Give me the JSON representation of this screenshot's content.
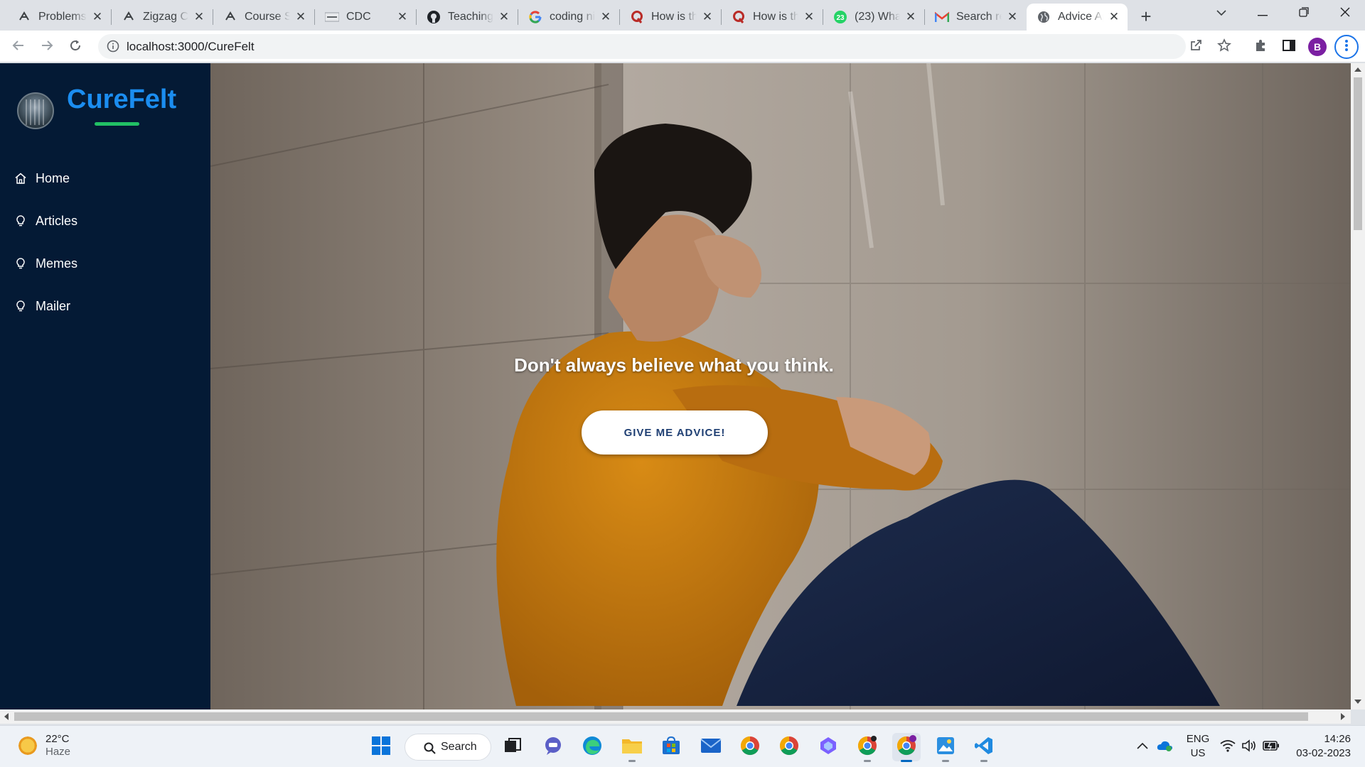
{
  "browser": {
    "tabs": [
      {
        "title": "Problems",
        "favicon": "gfg-icon"
      },
      {
        "title": "Zigzag Co",
        "favicon": "gfg-icon"
      },
      {
        "title": "Course Sc",
        "favicon": "gfg-icon"
      },
      {
        "title": "CDC",
        "favicon": "cdc-icon"
      },
      {
        "title": "Teaching",
        "favicon": "github-icon"
      },
      {
        "title": "coding ni",
        "favicon": "google-icon"
      },
      {
        "title": "How is th",
        "favicon": "quora-icon"
      },
      {
        "title": "How is th",
        "favicon": "quora-icon"
      },
      {
        "title": "(23) What",
        "favicon": "whatsapp-icon"
      },
      {
        "title": "Search re",
        "favicon": "gmail-icon"
      },
      {
        "title": "Advice Ap",
        "favicon": "globe-icon",
        "active": true
      }
    ],
    "url": "localhost:3000/CureFelt",
    "profile_initial": "B"
  },
  "sidebar": {
    "brand": "CureFelt",
    "items": [
      {
        "label": "Home",
        "icon": "home-icon"
      },
      {
        "label": "Articles",
        "icon": "lightbulb-icon"
      },
      {
        "label": "Memes",
        "icon": "lightbulb-icon"
      },
      {
        "label": "Mailer",
        "icon": "lightbulb-icon"
      }
    ]
  },
  "hero": {
    "quote": "Don't always believe what you think.",
    "button_label": "GIVE ME ADVICE!"
  },
  "taskbar": {
    "weather_temp": "22°C",
    "weather_condition": "Haze",
    "search_label": "Search",
    "lang_line1": "ENG",
    "lang_line2": "US",
    "time": "14:26",
    "date": "03-02-2023"
  },
  "colors": {
    "sidebar_bg": "#041a35",
    "brand": "#1b8df0",
    "brand_underline": "#21c064",
    "button_text": "#1f3f73"
  }
}
